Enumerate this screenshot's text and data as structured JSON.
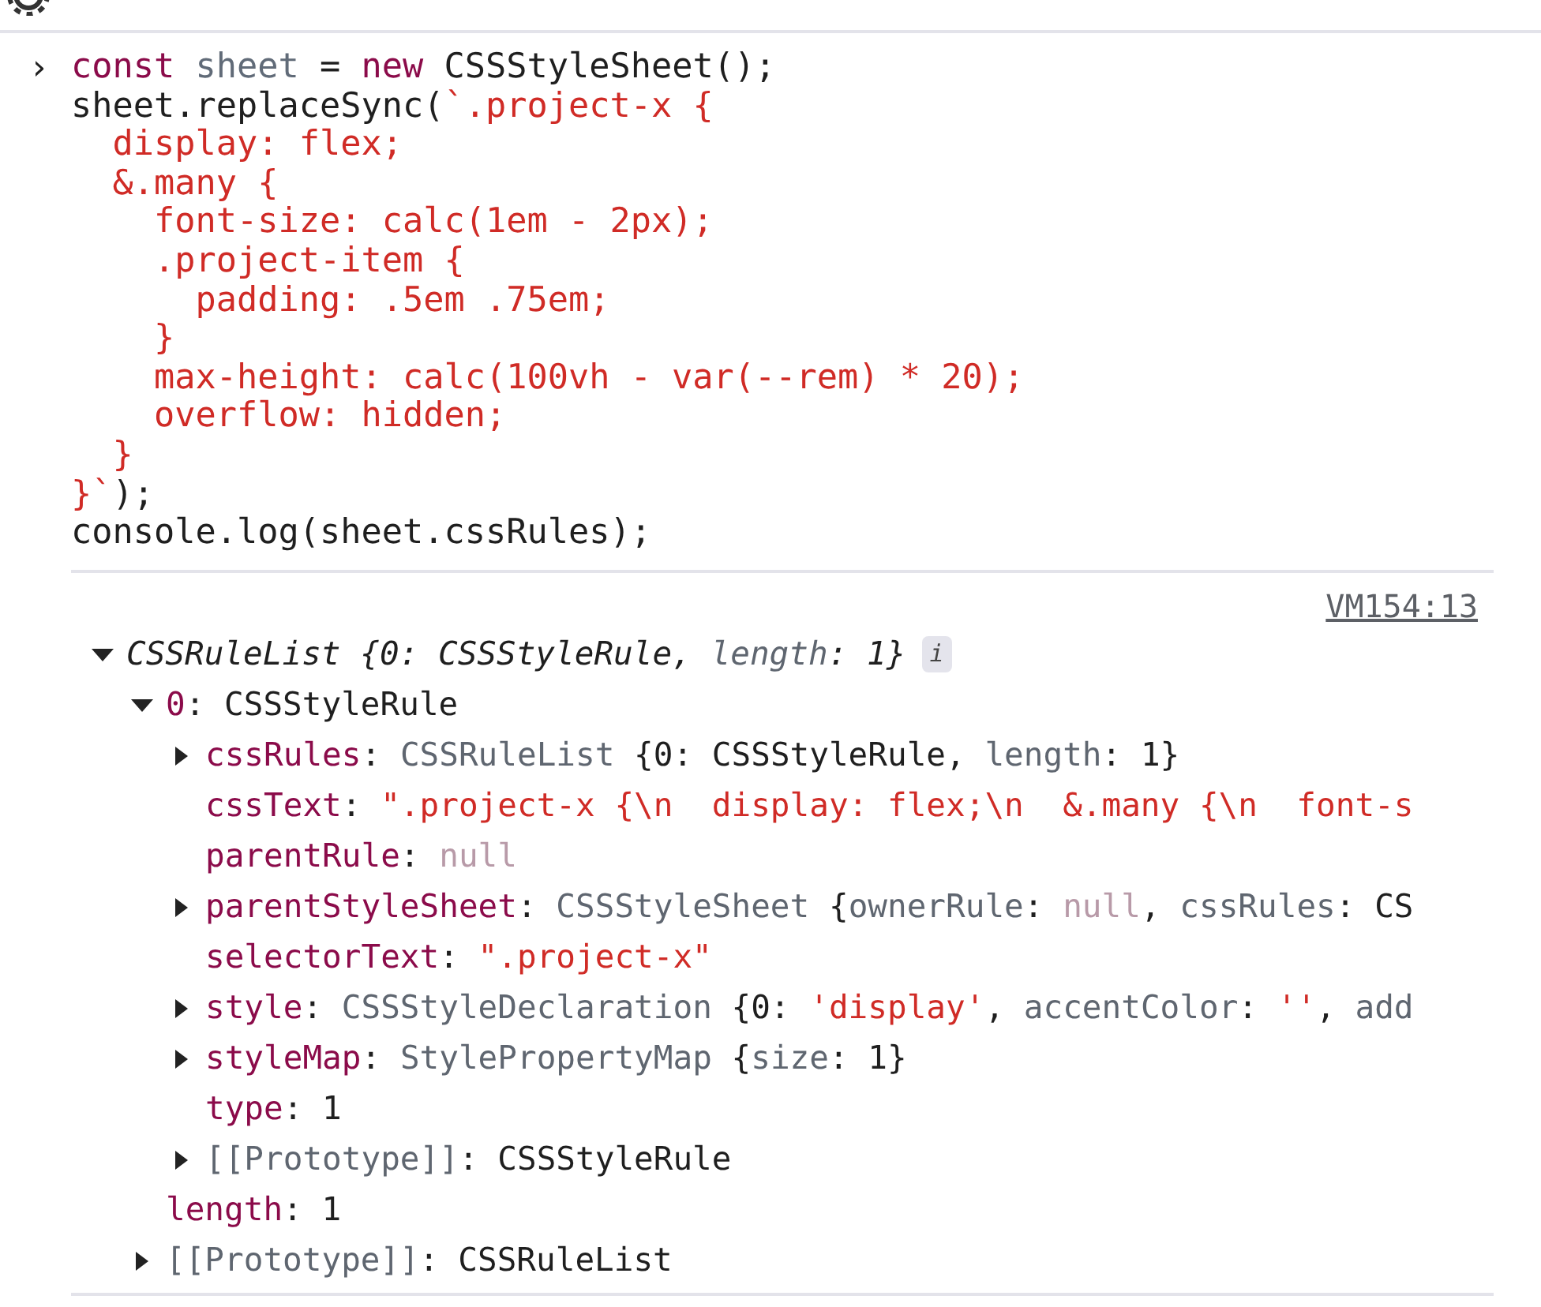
{
  "input": {
    "prompt": "›",
    "lines": [
      [
        {
          "kind": "keyword",
          "text": "const"
        },
        {
          "kind": "variable",
          "text": " sheet"
        },
        {
          "kind": "plain",
          "text": " = "
        },
        {
          "kind": "keyword",
          "text": "new"
        },
        {
          "kind": "plain",
          "text": " CSSStyleSheet();"
        }
      ],
      [
        {
          "kind": "plain",
          "text": "sheet.replaceSync("
        },
        {
          "kind": "string",
          "text": "`.project-x {"
        }
      ],
      [
        {
          "kind": "string",
          "text": "  display: flex;"
        }
      ],
      [
        {
          "kind": "string",
          "text": "  &.many {"
        }
      ],
      [
        {
          "kind": "string",
          "text": "    font-size: calc(1em - 2px);"
        }
      ],
      [
        {
          "kind": "string",
          "text": "    .project-item {"
        }
      ],
      [
        {
          "kind": "string",
          "text": "      padding: .5em .75em;"
        }
      ],
      [
        {
          "kind": "string",
          "text": "    }"
        }
      ],
      [
        {
          "kind": "string",
          "text": "    max-height: calc(100vh - var(--rem) * 20);"
        }
      ],
      [
        {
          "kind": "string",
          "text": "    overflow: hidden;"
        }
      ],
      [
        {
          "kind": "string",
          "text": "  }"
        }
      ],
      [
        {
          "kind": "string",
          "text": "}`"
        },
        {
          "kind": "plain",
          "text": ");"
        }
      ],
      [
        {
          "kind": "plain",
          "text": "console.log(sheet.cssRules);"
        }
      ]
    ]
  },
  "output": {
    "source": "VM154:13",
    "tree": [
      {
        "expanded": true,
        "italic": true,
        "info": "i",
        "parts": [
          {
            "kind": "value",
            "text": "CSSRuleList {0: CSSStyleRule, "
          },
          {
            "kind": "type",
            "text": "length"
          },
          {
            "kind": "value",
            "text": ": 1}"
          }
        ],
        "children": [
          {
            "expanded": true,
            "parts": [
              {
                "kind": "key",
                "text": "0"
              },
              {
                "kind": "value",
                "text": ": CSSStyleRule"
              }
            ],
            "children": [
              {
                "expanded": false,
                "parts": [
                  {
                    "kind": "key",
                    "text": "cssRules"
                  },
                  {
                    "kind": "value",
                    "text": ": "
                  },
                  {
                    "kind": "type",
                    "text": "CSSRuleList "
                  },
                  {
                    "kind": "value",
                    "text": "{0: CSSStyleRule, "
                  },
                  {
                    "kind": "type",
                    "text": "length"
                  },
                  {
                    "kind": "value",
                    "text": ": 1}"
                  }
                ]
              },
              {
                "parts": [
                  {
                    "kind": "key",
                    "text": "cssText"
                  },
                  {
                    "kind": "value",
                    "text": ": "
                  },
                  {
                    "kind": "string",
                    "text": "\".project-x {\\n  display: flex;\\n  &.many {\\n  font-s"
                  }
                ]
              },
              {
                "parts": [
                  {
                    "kind": "key",
                    "text": "parentRule"
                  },
                  {
                    "kind": "value",
                    "text": ": "
                  },
                  {
                    "kind": "null",
                    "text": "null"
                  }
                ]
              },
              {
                "expanded": false,
                "parts": [
                  {
                    "kind": "key",
                    "text": "parentStyleSheet"
                  },
                  {
                    "kind": "value",
                    "text": ": "
                  },
                  {
                    "kind": "type",
                    "text": "CSSStyleSheet "
                  },
                  {
                    "kind": "value",
                    "text": "{"
                  },
                  {
                    "kind": "type",
                    "text": "ownerRule"
                  },
                  {
                    "kind": "value",
                    "text": ": "
                  },
                  {
                    "kind": "null",
                    "text": "null"
                  },
                  {
                    "kind": "value",
                    "text": ", "
                  },
                  {
                    "kind": "type",
                    "text": "cssRules"
                  },
                  {
                    "kind": "value",
                    "text": ": CS"
                  }
                ]
              },
              {
                "parts": [
                  {
                    "kind": "key",
                    "text": "selectorText"
                  },
                  {
                    "kind": "value",
                    "text": ": "
                  },
                  {
                    "kind": "string",
                    "text": "\".project-x\""
                  }
                ]
              },
              {
                "expanded": false,
                "parts": [
                  {
                    "kind": "key",
                    "text": "style"
                  },
                  {
                    "kind": "value",
                    "text": ": "
                  },
                  {
                    "kind": "type",
                    "text": "CSSStyleDeclaration "
                  },
                  {
                    "kind": "value",
                    "text": "{0: "
                  },
                  {
                    "kind": "string",
                    "text": "'display'"
                  },
                  {
                    "kind": "value",
                    "text": ", "
                  },
                  {
                    "kind": "type",
                    "text": "accentColor"
                  },
                  {
                    "kind": "value",
                    "text": ": "
                  },
                  {
                    "kind": "string",
                    "text": "''"
                  },
                  {
                    "kind": "value",
                    "text": ", "
                  },
                  {
                    "kind": "type",
                    "text": "add"
                  }
                ]
              },
              {
                "expanded": false,
                "parts": [
                  {
                    "kind": "key",
                    "text": "styleMap"
                  },
                  {
                    "kind": "value",
                    "text": ": "
                  },
                  {
                    "kind": "type",
                    "text": "StylePropertyMap "
                  },
                  {
                    "kind": "value",
                    "text": "{"
                  },
                  {
                    "kind": "type",
                    "text": "size"
                  },
                  {
                    "kind": "value",
                    "text": ": 1}"
                  }
                ]
              },
              {
                "parts": [
                  {
                    "kind": "key",
                    "text": "type"
                  },
                  {
                    "kind": "value",
                    "text": ": 1"
                  }
                ]
              },
              {
                "expanded": false,
                "parts": [
                  {
                    "kind": "type",
                    "text": "[[Prototype]]"
                  },
                  {
                    "kind": "value",
                    "text": ": CSSStyleRule"
                  }
                ]
              }
            ]
          },
          {
            "parts": [
              {
                "kind": "key",
                "text": "length"
              },
              {
                "kind": "value",
                "text": ": 1"
              }
            ]
          },
          {
            "expanded": false,
            "parts": [
              {
                "kind": "type",
                "text": "[[Prototype]]"
              },
              {
                "kind": "value",
                "text": ": CSSRuleList"
              }
            ]
          }
        ]
      }
    ]
  }
}
